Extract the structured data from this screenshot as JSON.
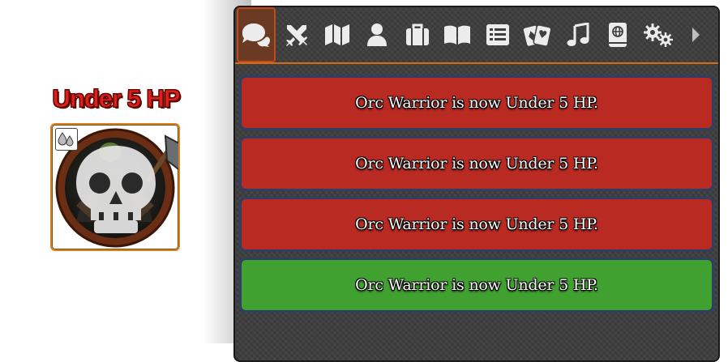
{
  "token": {
    "status_title": "Under 5 HP",
    "name": "Orc Warrior",
    "status_icon": "blood-drops-icon",
    "overlay_icon": "skull-icon"
  },
  "chat": {
    "tabs": [
      {
        "icon": "chat-bubbles-icon",
        "active": true
      },
      {
        "icon": "crossed-swords-icon"
      },
      {
        "icon": "map-icon"
      },
      {
        "icon": "user-icon"
      },
      {
        "icon": "briefcase-icon"
      },
      {
        "icon": "open-book-icon"
      },
      {
        "icon": "list-icon"
      },
      {
        "icon": "cards-icon"
      },
      {
        "icon": "music-note-icon"
      },
      {
        "icon": "compendium-icon"
      },
      {
        "icon": "cogs-icon"
      },
      {
        "icon": "chevron-right-icon"
      }
    ],
    "messages": [
      {
        "text": "Orc Warrior is now Under 5 HP.",
        "color": "#b82a22"
      },
      {
        "text": "Orc Warrior is now Under 5 HP.",
        "color": "#b82a22"
      },
      {
        "text": "Orc Warrior is now Under 5 HP.",
        "color": "#b82a22"
      },
      {
        "text": "Orc Warrior is now Under 5 HP.",
        "color": "#40a030"
      }
    ],
    "accent_color": "#d96a18"
  }
}
